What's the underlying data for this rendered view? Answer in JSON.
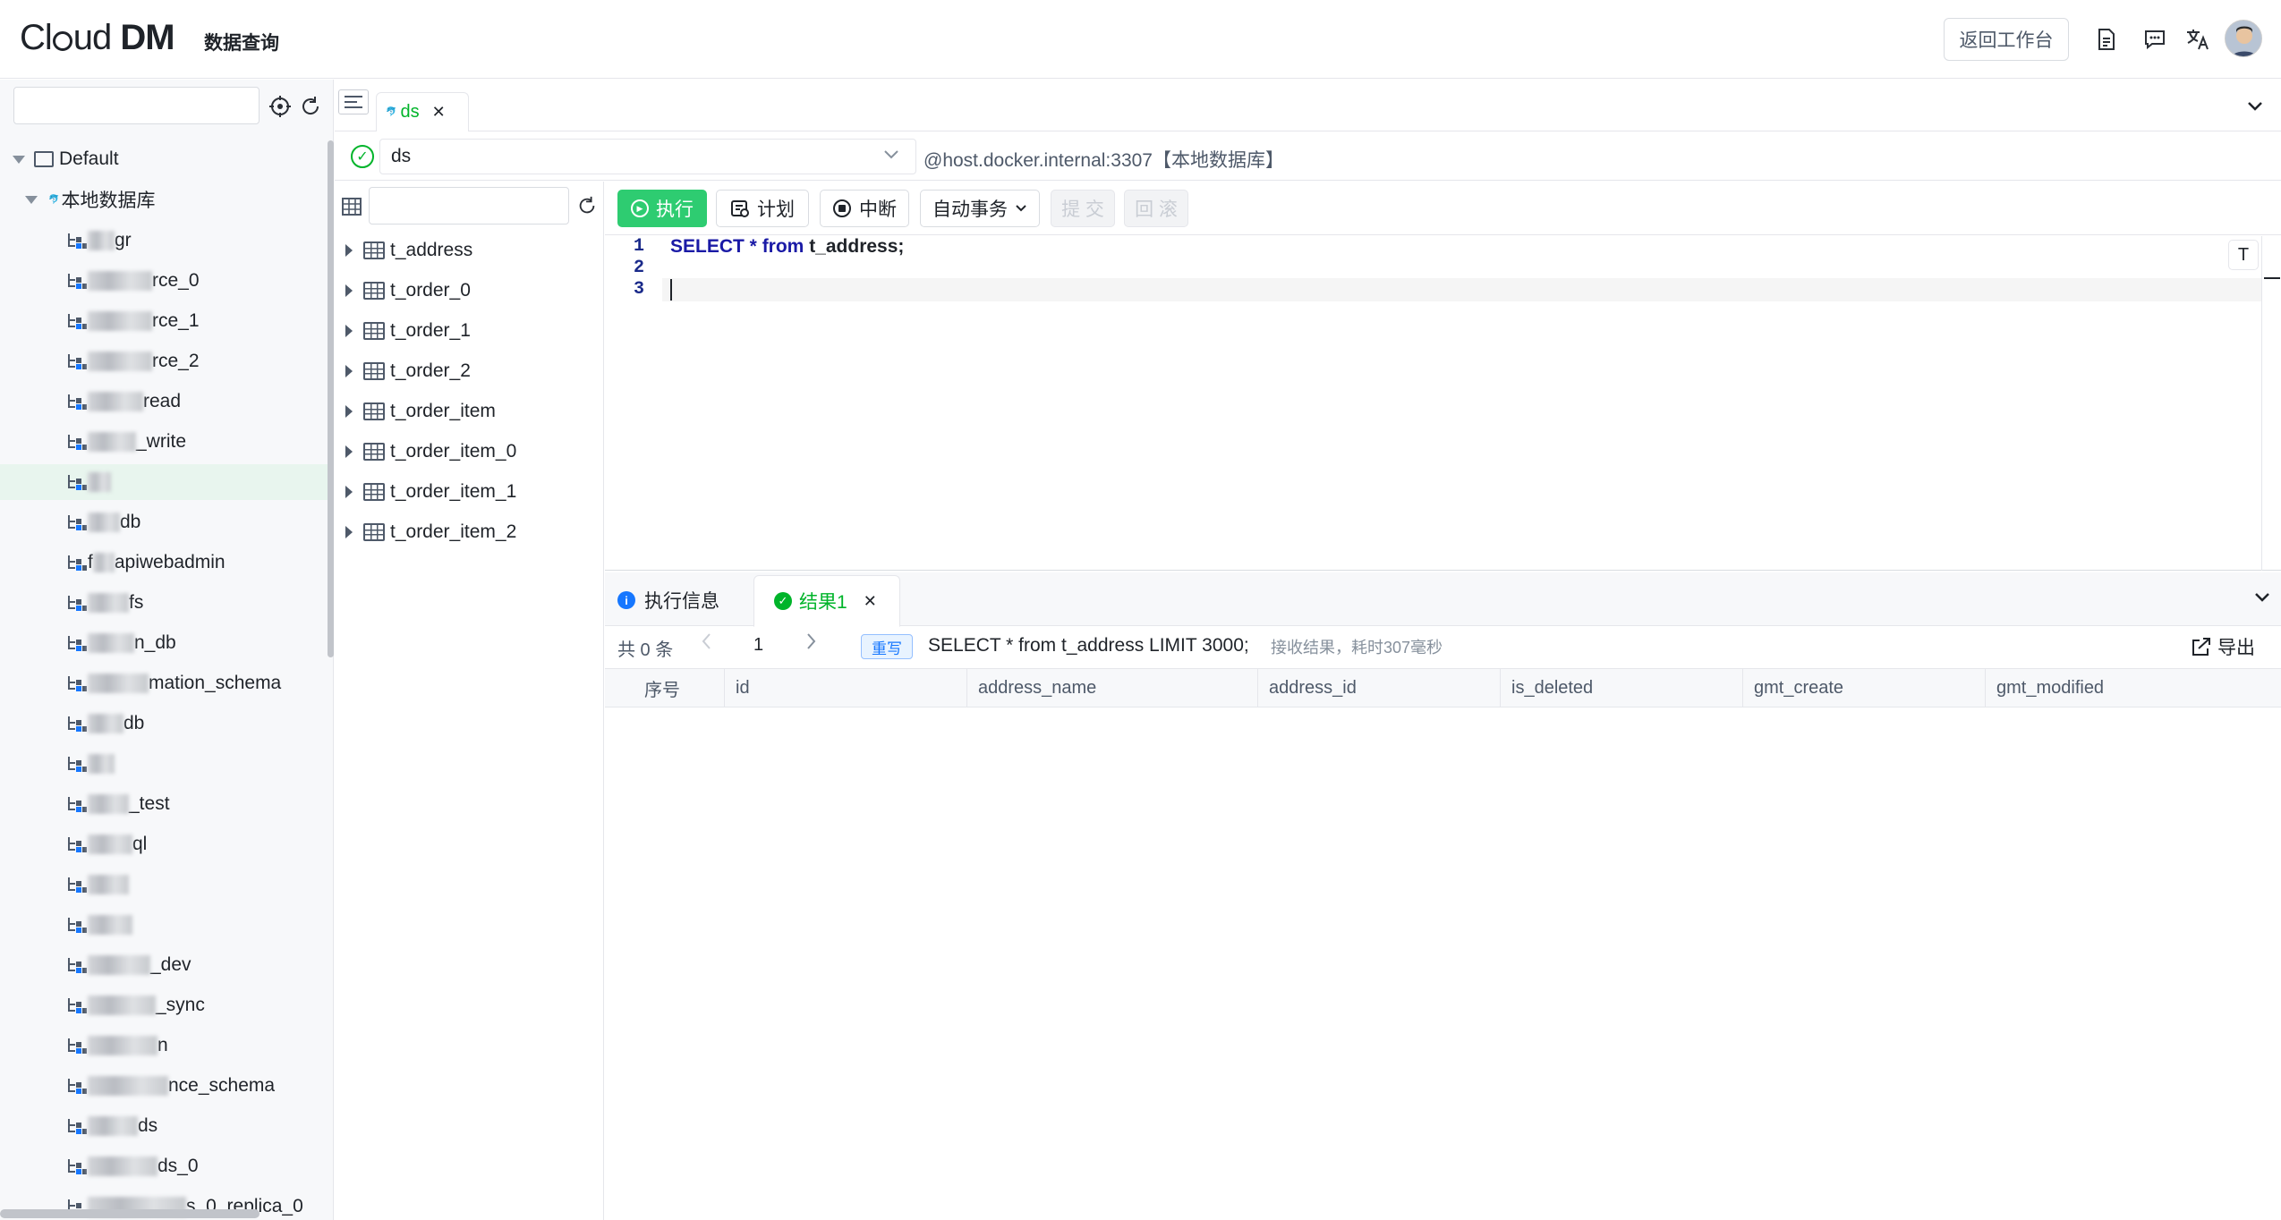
{
  "app": {
    "logo_text_a": "Cl",
    "logo_text_b": "ud ",
    "logo_text_c": "DM",
    "subtitle": "数据查询",
    "back_button": "返回工作台"
  },
  "sidebar": {
    "search_placeholder": "",
    "root": "Default",
    "connection": "本地数据库",
    "databases": [
      {
        "prefix": "",
        "suffix": "gr"
      },
      {
        "prefix": "",
        "suffix": "rce_0"
      },
      {
        "prefix": "",
        "suffix": "rce_1"
      },
      {
        "prefix": "",
        "suffix": "rce_2"
      },
      {
        "prefix": "",
        "suffix": "read"
      },
      {
        "prefix": "",
        "suffix": "_write"
      },
      {
        "prefix": "",
        "suffix": ""
      },
      {
        "prefix": "",
        "suffix": "db"
      },
      {
        "prefix": "f",
        "suffix": "apiwebadmin"
      },
      {
        "prefix": "",
        "suffix": "fs"
      },
      {
        "prefix": "",
        "suffix": "n_db"
      },
      {
        "prefix": "",
        "suffix": "mation_schema"
      },
      {
        "prefix": "",
        "suffix": "db"
      },
      {
        "prefix": "",
        "suffix": ""
      },
      {
        "prefix": "",
        "suffix": "_test"
      },
      {
        "prefix": "",
        "suffix": "ql"
      },
      {
        "prefix": "",
        "suffix": ""
      },
      {
        "prefix": "",
        "suffix": ""
      },
      {
        "prefix": "",
        "suffix": "_dev"
      },
      {
        "prefix": "",
        "suffix": "_sync"
      },
      {
        "prefix": "",
        "suffix": "n"
      },
      {
        "prefix": "",
        "suffix": "nce_schema"
      },
      {
        "prefix": "",
        "suffix": "ds"
      },
      {
        "prefix": "",
        "suffix": "ds_0"
      },
      {
        "prefix": "",
        "suffix": "s_0_replica_0"
      }
    ],
    "selected_index": 6
  },
  "tabs": [
    {
      "label": "ds"
    }
  ],
  "datasource": {
    "selected": "ds",
    "host": "@host.docker.internal:3307【本地数据库】"
  },
  "tables": {
    "search_placeholder": "",
    "items": [
      "t_address",
      "t_order_0",
      "t_order_1",
      "t_order_2",
      "t_order_item",
      "t_order_item_0",
      "t_order_item_1",
      "t_order_item_2"
    ]
  },
  "toolbar": {
    "run": "执行",
    "plan": "计划",
    "stop": "中断",
    "txn_mode": "自动事务",
    "commit": "提 交",
    "rollback": "回 滚"
  },
  "editor": {
    "line_numbers": [
      "1",
      "2",
      "3"
    ],
    "code": {
      "kw1": "SELECT",
      "star": " * ",
      "kw2": "from",
      "rest": " t_address;"
    },
    "format_button": "T"
  },
  "results": {
    "tab_info": "执行信息",
    "tab_result": "结果1",
    "count": "共 0 条",
    "page": "1",
    "rewrite_badge": "重写",
    "sql": "SELECT * from t_address LIMIT 3000;",
    "meta": "接收结果，耗时307毫秒",
    "export": "导出",
    "columns": [
      "序号",
      "id",
      "address_name",
      "address_id",
      "is_deleted",
      "gmt_create",
      "gmt_modified"
    ]
  },
  "colors": {
    "accent_green": "#2ecc71",
    "success_green": "#00b42a",
    "keyword_blue": "#1a1aa6",
    "info_blue": "#1677ff"
  }
}
